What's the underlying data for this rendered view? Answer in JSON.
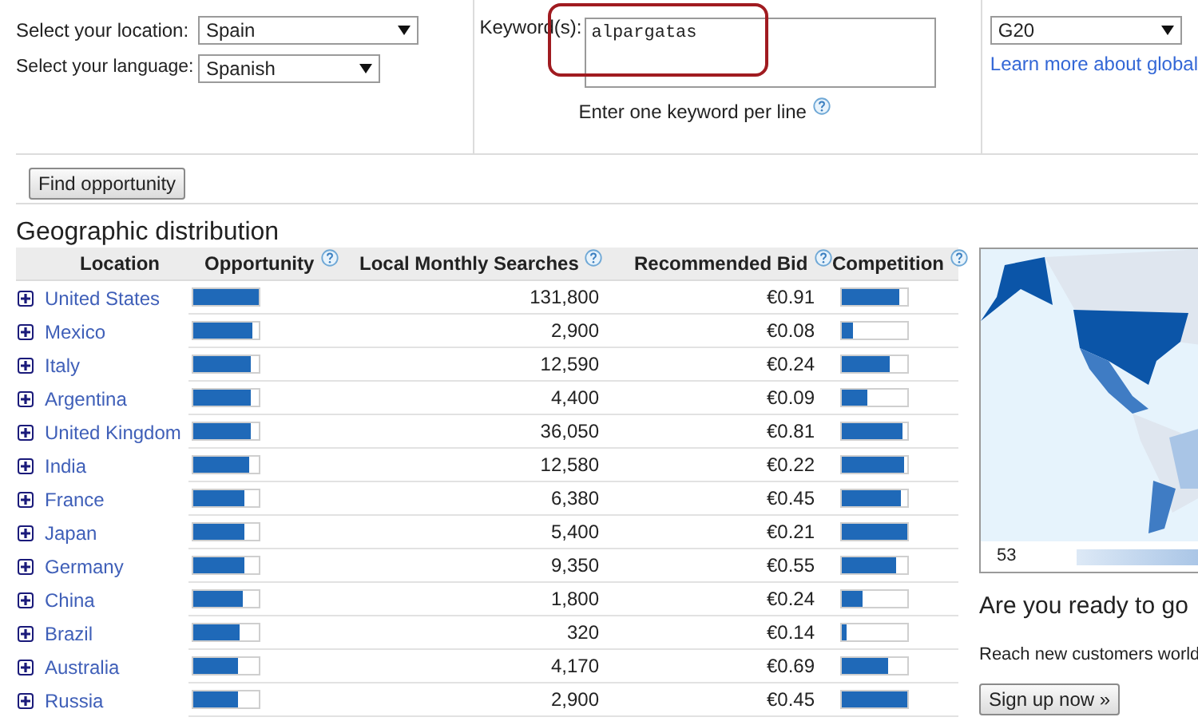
{
  "form": {
    "location_label": "Select your location:",
    "location": "Spain",
    "language_label": "Select your language:",
    "language": "Spanish",
    "keywords_label": "Keyword(s):",
    "keywords": "alpargatas",
    "keywords_hint": "Enter one keyword per line",
    "group": "G20",
    "learn_link": "Learn more about global",
    "highlight": true,
    "find_button": "Find opportunity"
  },
  "section_title": "Geographic distribution",
  "table": {
    "columns": [
      "Location",
      "Opportunity",
      "Local Monthly Searches",
      "Recommended Bid",
      "Competition"
    ],
    "rows": [
      {
        "location": "United States",
        "opportunity": {
          "level": 1.0
        },
        "searches": "131,800",
        "bid": "€0.91",
        "competition": {
          "level": 0.89
        }
      },
      {
        "location": "Mexico",
        "opportunity": {
          "level": 0.9
        },
        "searches": "2,900",
        "bid": "€0.08",
        "competition": {
          "level": 0.18
        }
      },
      {
        "location": "Italy",
        "opportunity": {
          "level": 0.87
        },
        "searches": "12,590",
        "bid": "€0.24",
        "competition": {
          "level": 0.73
        }
      },
      {
        "location": "Argentina",
        "opportunity": {
          "level": 0.87
        },
        "searches": "4,400",
        "bid": "€0.09",
        "competition": {
          "level": 0.38
        }
      },
      {
        "location": "United Kingdom",
        "opportunity": {
          "level": 0.87
        },
        "searches": "36,050",
        "bid": "€0.81",
        "competition": {
          "level": 0.93
        }
      },
      {
        "location": "India",
        "opportunity": {
          "level": 0.86
        },
        "searches": "12,580",
        "bid": "€0.22",
        "competition": {
          "level": 0.95
        }
      },
      {
        "location": "France",
        "opportunity": {
          "level": 0.79
        },
        "searches": "6,380",
        "bid": "€0.45",
        "competition": {
          "level": 0.9
        }
      },
      {
        "location": "Japan",
        "opportunity": {
          "level": 0.79
        },
        "searches": "5,400",
        "bid": "€0.21",
        "competition": {
          "level": 1.0
        }
      },
      {
        "location": "Germany",
        "opportunity": {
          "level": 0.77
        },
        "searches": "9,350",
        "bid": "€0.55",
        "competition": {
          "level": 0.82
        }
      },
      {
        "location": "China",
        "opportunity": {
          "level": 0.75
        },
        "searches": "1,800",
        "bid": "€0.24",
        "competition": {
          "level": 0.32
        }
      },
      {
        "location": "Brazil",
        "opportunity": {
          "level": 0.71
        },
        "searches": "320",
        "bid": "€0.14",
        "competition": {
          "level": 0.08
        }
      },
      {
        "location": "Australia",
        "opportunity": {
          "level": 0.69
        },
        "searches": "4,170",
        "bid": "€0.69",
        "competition": {
          "level": 0.71
        }
      },
      {
        "location": "Russia",
        "opportunity": {
          "level": 0.69
        },
        "searches": "2,900",
        "bid": "€0.45",
        "competition": {
          "level": 1.0
        }
      }
    ]
  },
  "map": {
    "legend_min": "53"
  },
  "promo": {
    "title": "Are you ready to go",
    "text": "Reach new customers world",
    "button": "Sign up now »"
  }
}
